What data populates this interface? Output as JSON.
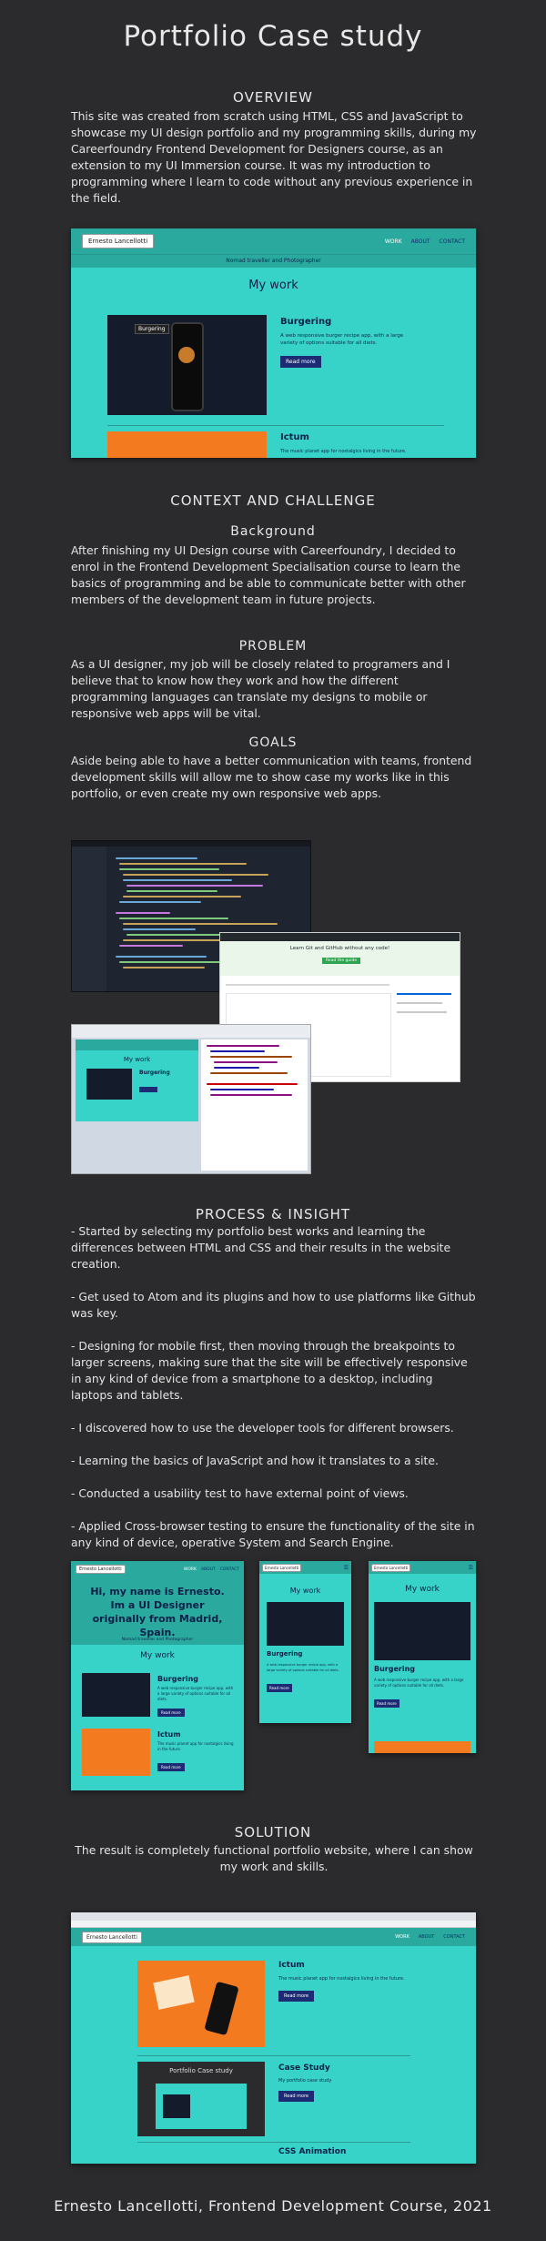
{
  "page": {
    "title": "Portfolio Case study",
    "footer": "Ernesto Lancellotti, Frontend Development Course, 2021"
  },
  "overview": {
    "heading": "OVERVIEW",
    "text": "This site was created from scratch using HTML, CSS and JavaScript  to showcase my UI design portfolio and my programming skills, during my Careerfoundry Frontend Development for Designers course, as an extension to my UI Immersion course. It was my introduction to programming where I learn to code without any previous experience in the field."
  },
  "site_preview": {
    "logo": "Ernesto Lancellotti",
    "nav": [
      "WORK",
      "ABOUT",
      "CONTACT"
    ],
    "tagline": "Nomad traveller and Photographer",
    "section_title": "My work",
    "project1": {
      "title": "Burgering",
      "desc": "A web responsive burger recipe app, with a large variety of options suitable for all diets.",
      "button": "Read more",
      "phone_text": "Burgering"
    },
    "project2": {
      "title": "Ictum",
      "desc": "The music planet app for nostalgics living in the future."
    }
  },
  "context": {
    "heading": "CONTEXT AND CHALLENGE",
    "background_heading": "Background",
    "background_text": "After finishing my UI Design course with Careerfoundry, I decided to enrol in the Frontend Development Specialisation course to learn the basics of programming and be able to communicate better with other members of the development team in future projects.",
    "problem_heading": "PROBLEM",
    "problem_text": "As a UI designer, my job will be closely related to programers and I believe that to know how they work and how the different programming languages can translate my designs to mobile or responsive web apps will be vital.",
    "goals_heading": "GOALS",
    "goals_text": "Aside being able to have a better communication with teams, frontend development skills will allow me to show case my works like in this portfolio, or even create my own responsive web apps."
  },
  "collage": {
    "github_banner": "Learn Git and GitHub without any code!",
    "github_button": "Read the guide",
    "devtools_title": "My work",
    "devtools_item": "Burgering"
  },
  "process": {
    "heading": "PROCESS & INSIGHT",
    "items": [
      "- Started by selecting my portfolio best works and learning the differences between HTML and CSS and their results in the website creation.",
      "- Get used to Atom and its plugins and how to use platforms like Github was key.",
      "- Designing for mobile first, then moving through the breakpoints to larger screens, making sure that the site will be effectively responsive in any kind of device from a smartphone to a desktop, including laptops and tablets.",
      "- I discovered how to use the developer tools for different browsers.",
      "- Learning the basics of JavaScript and how it translates to a site.",
      "- Conducted a usability test to have external point of views.",
      "- Applied Cross-browser testing to ensure the functionality of the site in any kind of device, operative System and Search Engine."
    ]
  },
  "responsive": {
    "logo": "Ernesto Lancellotti",
    "nav": [
      "WORK",
      "ABOUT",
      "CONTACT"
    ],
    "hero": "Hi, my name is Ernesto. Im a UI Designer originally from Madrid, Spain.",
    "tagline": "Nomad traveller and Photographer",
    "section_title": "My work",
    "p1_title": "Burgering",
    "p1_desc": "A web responsive burger recipe app, with a large variety of options suitable for all diets.",
    "p2_title": "Ictum",
    "p2_desc": "The music planet app for nostalgics living in the future.",
    "button": "Read more"
  },
  "solution": {
    "heading": "SOLUTION",
    "text": "The result is completely functional portfolio website, where I can show my work and skills.",
    "logo": "Ernesto Lancellotti",
    "nav": [
      "WORK",
      "ABOUT",
      "CONTACT"
    ],
    "p1_title": "Ictum",
    "p1_desc": "The music planet app for nostalgics living in the future.",
    "p2_title": "Case Study",
    "p2_desc": "My portfolio case study",
    "p2_thumb": "Portfolio Case study",
    "p3_title": "CSS Animation",
    "button": "Read more"
  },
  "colors": {
    "background": "#2b2b2d",
    "teal": "#37d3c9",
    "navy": "#1c2b73"
  }
}
